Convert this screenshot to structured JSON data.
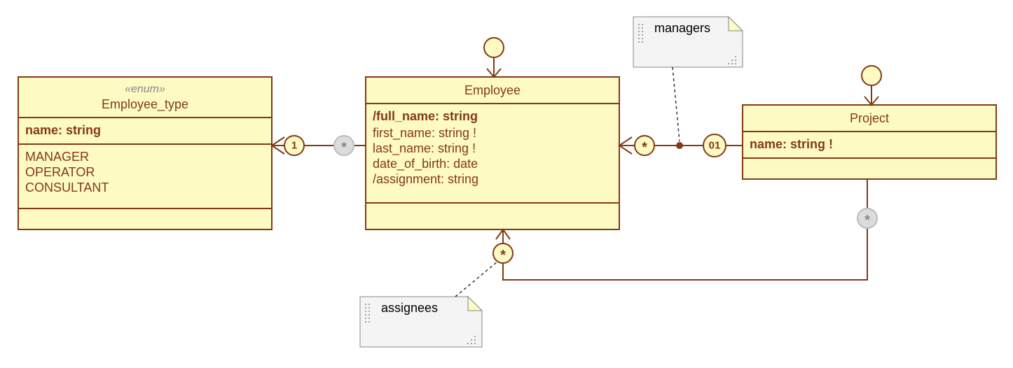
{
  "classes": {
    "employee_type": {
      "stereotype": "«enum»",
      "name": "Employee_type",
      "key_attr": "name: string",
      "values": [
        "MANAGER",
        "OPERATOR",
        "CONSULTANT"
      ]
    },
    "employee": {
      "name": "Employee",
      "key_attr": "/full_name: string",
      "attrs": [
        "first_name: string !",
        "last_name: string !",
        "date_of_birth: date",
        "/assignment: string"
      ]
    },
    "project": {
      "name": "Project",
      "key_attr": "name: string !"
    }
  },
  "notes": {
    "managers": "managers",
    "assignees": "assignees"
  },
  "multiplicities": {
    "emp_to_type_near": "*",
    "emp_to_type_far": "1",
    "emp_self": "",
    "emp_proj_mgr_near": "*",
    "emp_proj_mgr_far": "01",
    "proj_self": "*",
    "emp_proj_assign_near": "*"
  }
}
